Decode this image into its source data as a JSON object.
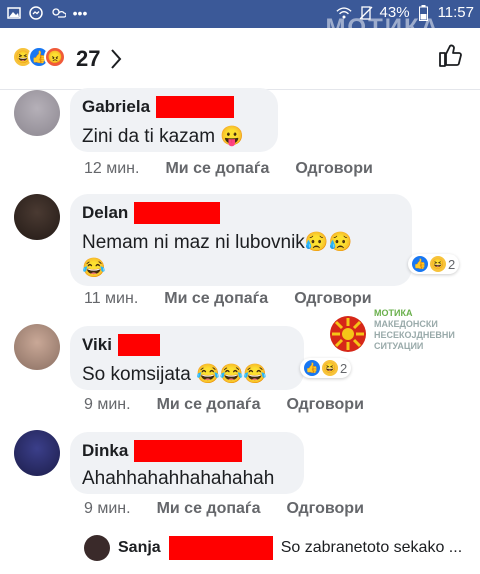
{
  "status": {
    "battery": "43%",
    "time": "11:57",
    "watermark": "МОТИКА"
  },
  "header": {
    "reaction_count": "27",
    "reactions": [
      "haha-icon",
      "like-icon",
      "angry-icon"
    ]
  },
  "comments": [
    {
      "name": "Gabriela",
      "text": "Zini da ti kazam 😛",
      "time": "12 мин.",
      "like_label": "Ми се допаѓа",
      "reply_label": "Одговори"
    },
    {
      "name": "Delan",
      "text_line1": "Nemam ni maz ni lubovnik😥😥",
      "text_line2": "😂",
      "time": "11 мин.",
      "like_label": "Ми се допаѓа",
      "reply_label": "Одговори",
      "reaction_count": "2"
    },
    {
      "name": "Viki",
      "text": "So komsijata 😂😂😂",
      "time": "9 мин.",
      "like_label": "Ми се допаѓа",
      "reply_label": "Одговори",
      "reaction_count": "2"
    },
    {
      "name": "Dinka",
      "text": "Ahahhahahhahahahah",
      "time": "9 мин.",
      "like_label": "Ми се допаѓа",
      "reply_label": "Одговори"
    }
  ],
  "reply_preview": {
    "name": "Sanja",
    "text": "So zabranetoto sekako ..."
  },
  "logo": {
    "brand": "МОТИКА",
    "line1": "МАКЕДОНСКИ",
    "line2": "НЕСЕКОЈДНЕВНИ",
    "line3": "СИТУАЦИИ"
  },
  "colors": {
    "facebook_blue": "#3b5998",
    "like_blue": "#1877f2",
    "bubble_bg": "#f0f2f5",
    "redaction": "#ff0000"
  }
}
